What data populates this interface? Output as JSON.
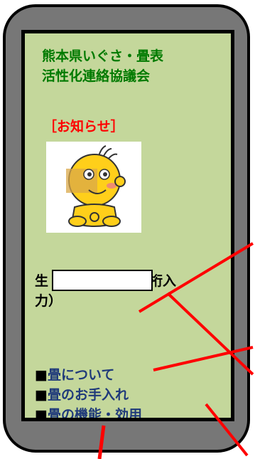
{
  "header": {
    "org_name": "熊本県いぐさ・畳表\n活性化連絡協議会"
  },
  "notice": {
    "heading": "［お知らせ］"
  },
  "mascot": {
    "icon": "mascot-character-icon"
  },
  "redacted_text": {
    "visible_start": "生",
    "visible_end": "桁入",
    "visible_line2": "力）"
  },
  "menu": {
    "items": [
      {
        "bullet": "■",
        "label": "畳について"
      },
      {
        "bullet": "■",
        "label": "畳のお手入れ"
      },
      {
        "bullet": "■",
        "label": "畳の機能・効用"
      }
    ]
  },
  "colors": {
    "frame": "#777777",
    "screen_bg": "#c4d79b",
    "title": "#007a00",
    "notice": "#ff0000",
    "menu_link": "#1f3a7a",
    "overlay_lines": "#ff0000"
  }
}
